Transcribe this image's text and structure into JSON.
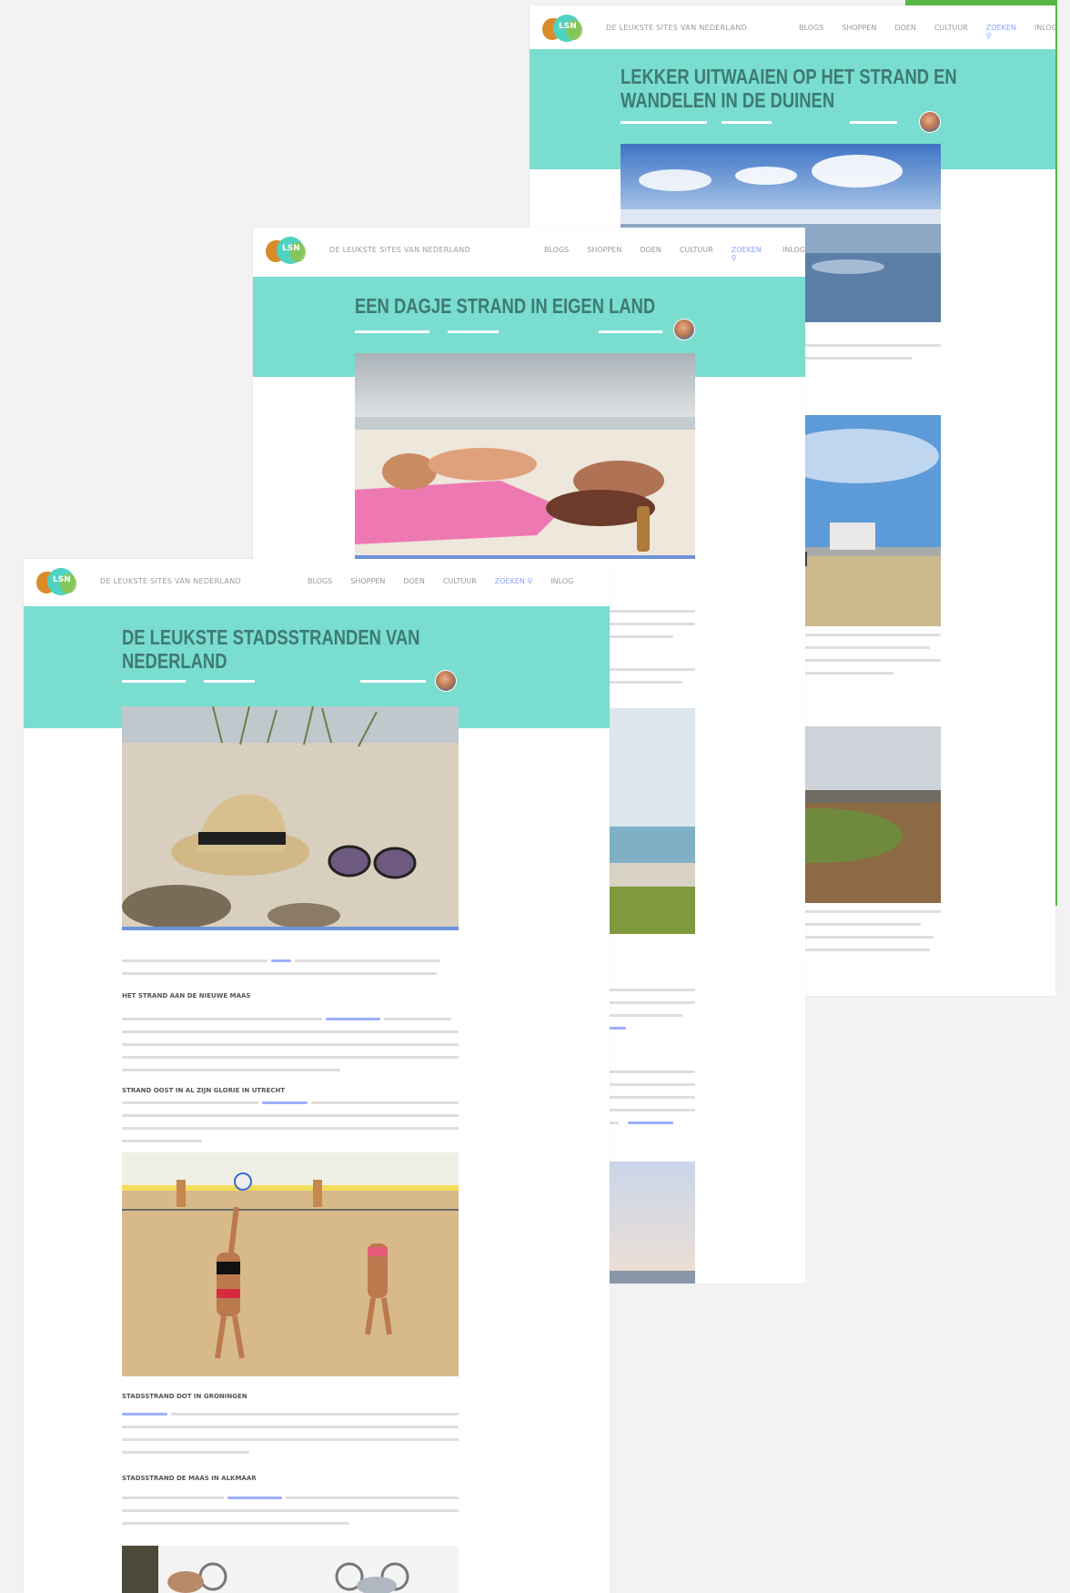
{
  "site": {
    "tagline": "De leukste sites van Nederland",
    "logo_text": "LSN",
    "menu": [
      "Blogs",
      "Shoppen",
      "Doen",
      "Cultuur",
      "Zoeken",
      "Inlog"
    ],
    "active_menu": "Zoeken",
    "banner_color": "#79ddd0",
    "accent_green": "#56b947"
  },
  "articles": {
    "back": {
      "title_line1": "Lekker uitwaaien op het strand en",
      "title_line2": "wandelen in de duinen"
    },
    "middle": {
      "title_line1": "Een dagje strand in eigen land"
    },
    "front": {
      "title_line1": "De leukste stadsstranden van",
      "title_line2": "Nederland",
      "subheadings": [
        "Het strand aan de Nieuwe Maas",
        "Strand Oost in al zijn glorie in Utrecht",
        "Stadsstrand Dot in Groningen",
        "Stadsstrand de Maas in Alkmaar"
      ]
    }
  }
}
